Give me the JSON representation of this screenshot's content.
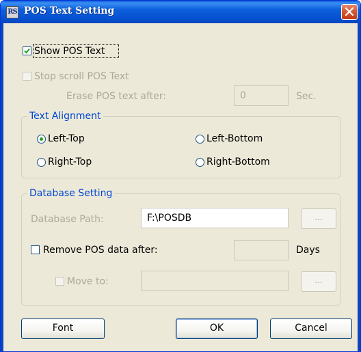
{
  "window": {
    "title": "POS Text Setting",
    "icon_text": "RS"
  },
  "show_pos_text": {
    "label": "Show POS Text",
    "checked": true
  },
  "stop_scroll": {
    "label": "Stop scroll POS Text",
    "checked": false,
    "enabled": false
  },
  "erase": {
    "label": "Erase POS text after:",
    "value": "0",
    "unit": "Sec."
  },
  "text_alignment": {
    "title": "Text Alignment",
    "options": [
      {
        "label": "Left-Top",
        "selected": true
      },
      {
        "label": "Left-Bottom",
        "selected": false
      },
      {
        "label": "Right-Top",
        "selected": false
      },
      {
        "label": "Right-Bottom",
        "selected": false
      }
    ]
  },
  "database": {
    "title": "Database Setting",
    "path_label": "Database Path:",
    "path_value": "F:\\POSDB",
    "browse_label": "...",
    "remove_label": "Remove POS data after:",
    "remove_value": "",
    "remove_unit": "Days",
    "move_label": "Move to:",
    "move_value": "",
    "move_browse_label": "..."
  },
  "buttons": {
    "font": "Font",
    "ok": "OK",
    "cancel": "Cancel"
  },
  "colors": {
    "titlebar": "#0a5fd8",
    "face": "#ece9d8",
    "group_title": "#0046d5",
    "disabled_text": "#aca899"
  }
}
